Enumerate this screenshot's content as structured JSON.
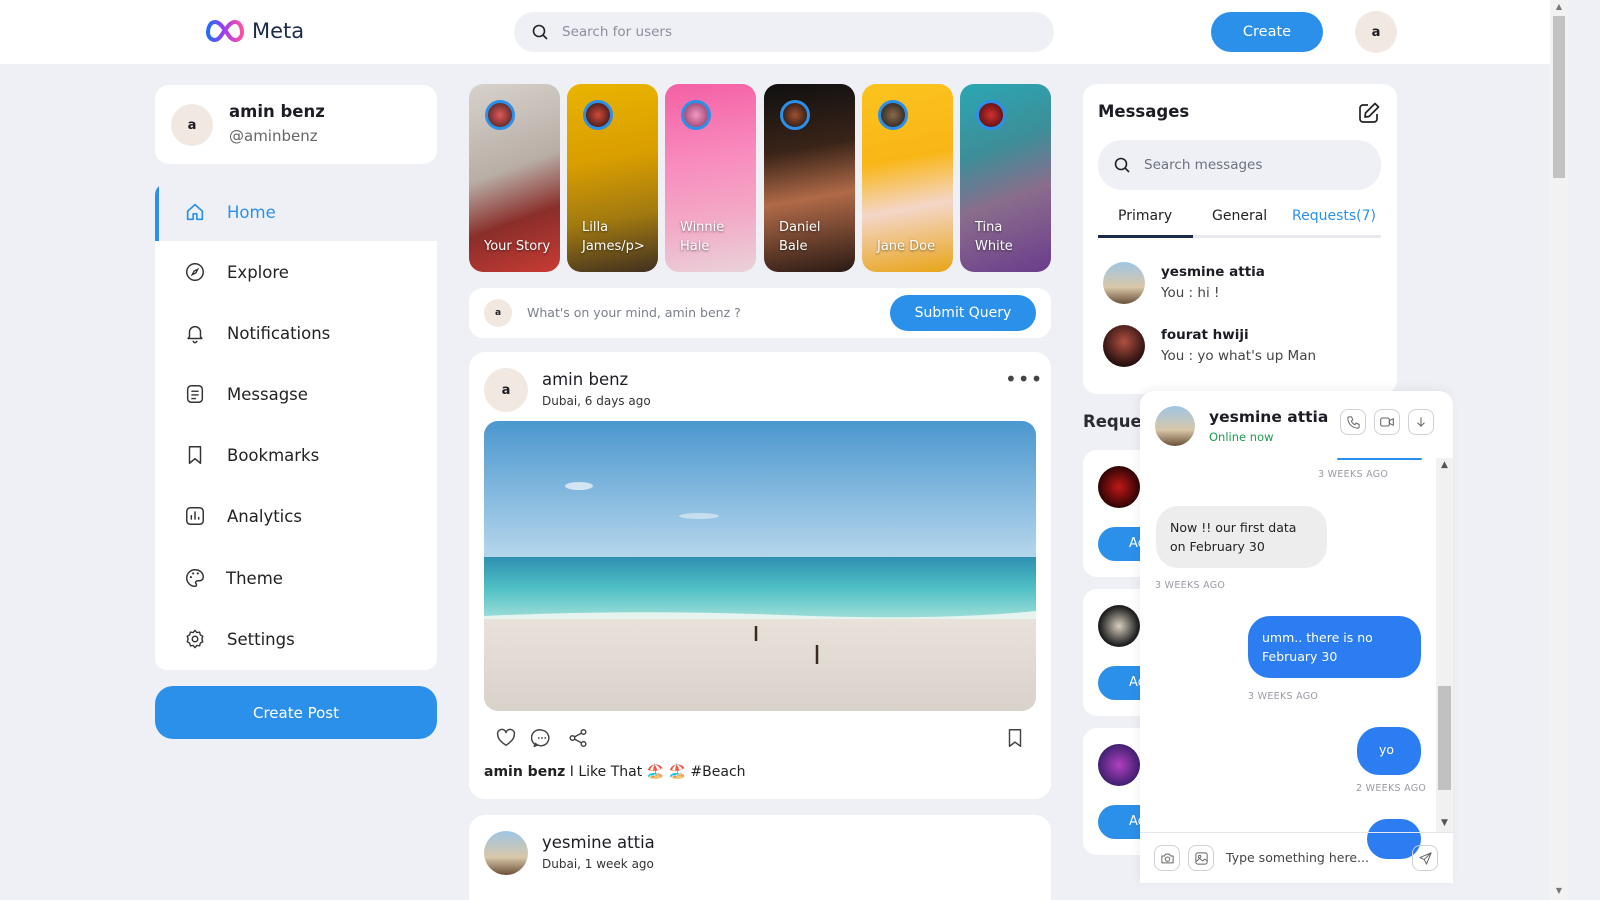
{
  "brand": {
    "name": "Meta"
  },
  "topbar": {
    "search_placeholder": "Search for users",
    "create_label": "Create",
    "avatar_letter": "a"
  },
  "profile": {
    "name": "amin benz",
    "handle": "@aminbenz",
    "avatar_letter": "a"
  },
  "nav": {
    "items": [
      {
        "label": "Home",
        "icon": "home-icon",
        "active": true
      },
      {
        "label": "Explore",
        "icon": "compass-icon"
      },
      {
        "label": "Notifications",
        "icon": "bell-icon"
      },
      {
        "label": "Messagse",
        "icon": "message-icon"
      },
      {
        "label": "Bookmarks",
        "icon": "bookmark-icon"
      },
      {
        "label": "Analytics",
        "icon": "analytics-icon"
      },
      {
        "label": "Theme",
        "icon": "palette-icon"
      },
      {
        "label": "Settings",
        "icon": "gear-icon"
      }
    ]
  },
  "create_post_label": "Create Post",
  "stories": [
    {
      "name_line1": "Your Story",
      "name_line2": ""
    },
    {
      "name_line1": "Lilla",
      "name_line2": "James/p>"
    },
    {
      "name_line1": "Winnie",
      "name_line2": "Hale"
    },
    {
      "name_line1": "Daniel",
      "name_line2": "Bale"
    },
    {
      "name_line1": "Jane Doe",
      "name_line2": ""
    },
    {
      "name_line1": "Tina",
      "name_line2": "White"
    }
  ],
  "composer": {
    "avatar_letter": "a",
    "placeholder": "What's on your mind, amin benz ?",
    "submit_label": "Submit Query"
  },
  "posts": [
    {
      "avatar_letter": "a",
      "author": "amin benz",
      "meta": "Dubai, 6 days ago",
      "caption_author": "amin benz",
      "caption_text": "I Like That 🏖️ 🏖️ #Beach"
    },
    {
      "author": "yesmine attia",
      "meta": "Dubai, 1 week ago"
    }
  ],
  "messages": {
    "title": "Messages",
    "search_placeholder": "Search messages",
    "tabs": [
      "Primary",
      "General",
      "Requests(7)"
    ],
    "conversations": [
      {
        "name": "yesmine attia",
        "last": "You : hi !"
      },
      {
        "name": "fourat hwiji",
        "last": "You : yo what's up Man"
      }
    ]
  },
  "requests": {
    "heading": "Reques",
    "accept_partial": "Ac"
  },
  "chat": {
    "name": "yesmine attia",
    "status": "Online now",
    "messages": [
      {
        "ts": "3 WEEKS AGO"
      },
      {
        "dir": "in",
        "text": "Now !! our first data on February 30",
        "ts": "3 WEEKS AGO"
      },
      {
        "dir": "out",
        "text": "umm.. there is no February 30",
        "ts": "3 WEEKS AGO"
      },
      {
        "dir": "out",
        "text": "yo",
        "ts": "2 WEEKS AGO"
      }
    ],
    "input_placeholder": "Type something here..."
  },
  "colors": {
    "accent": "#2b90ea",
    "online": "#1e9b4e",
    "background": "#eef0f6"
  }
}
